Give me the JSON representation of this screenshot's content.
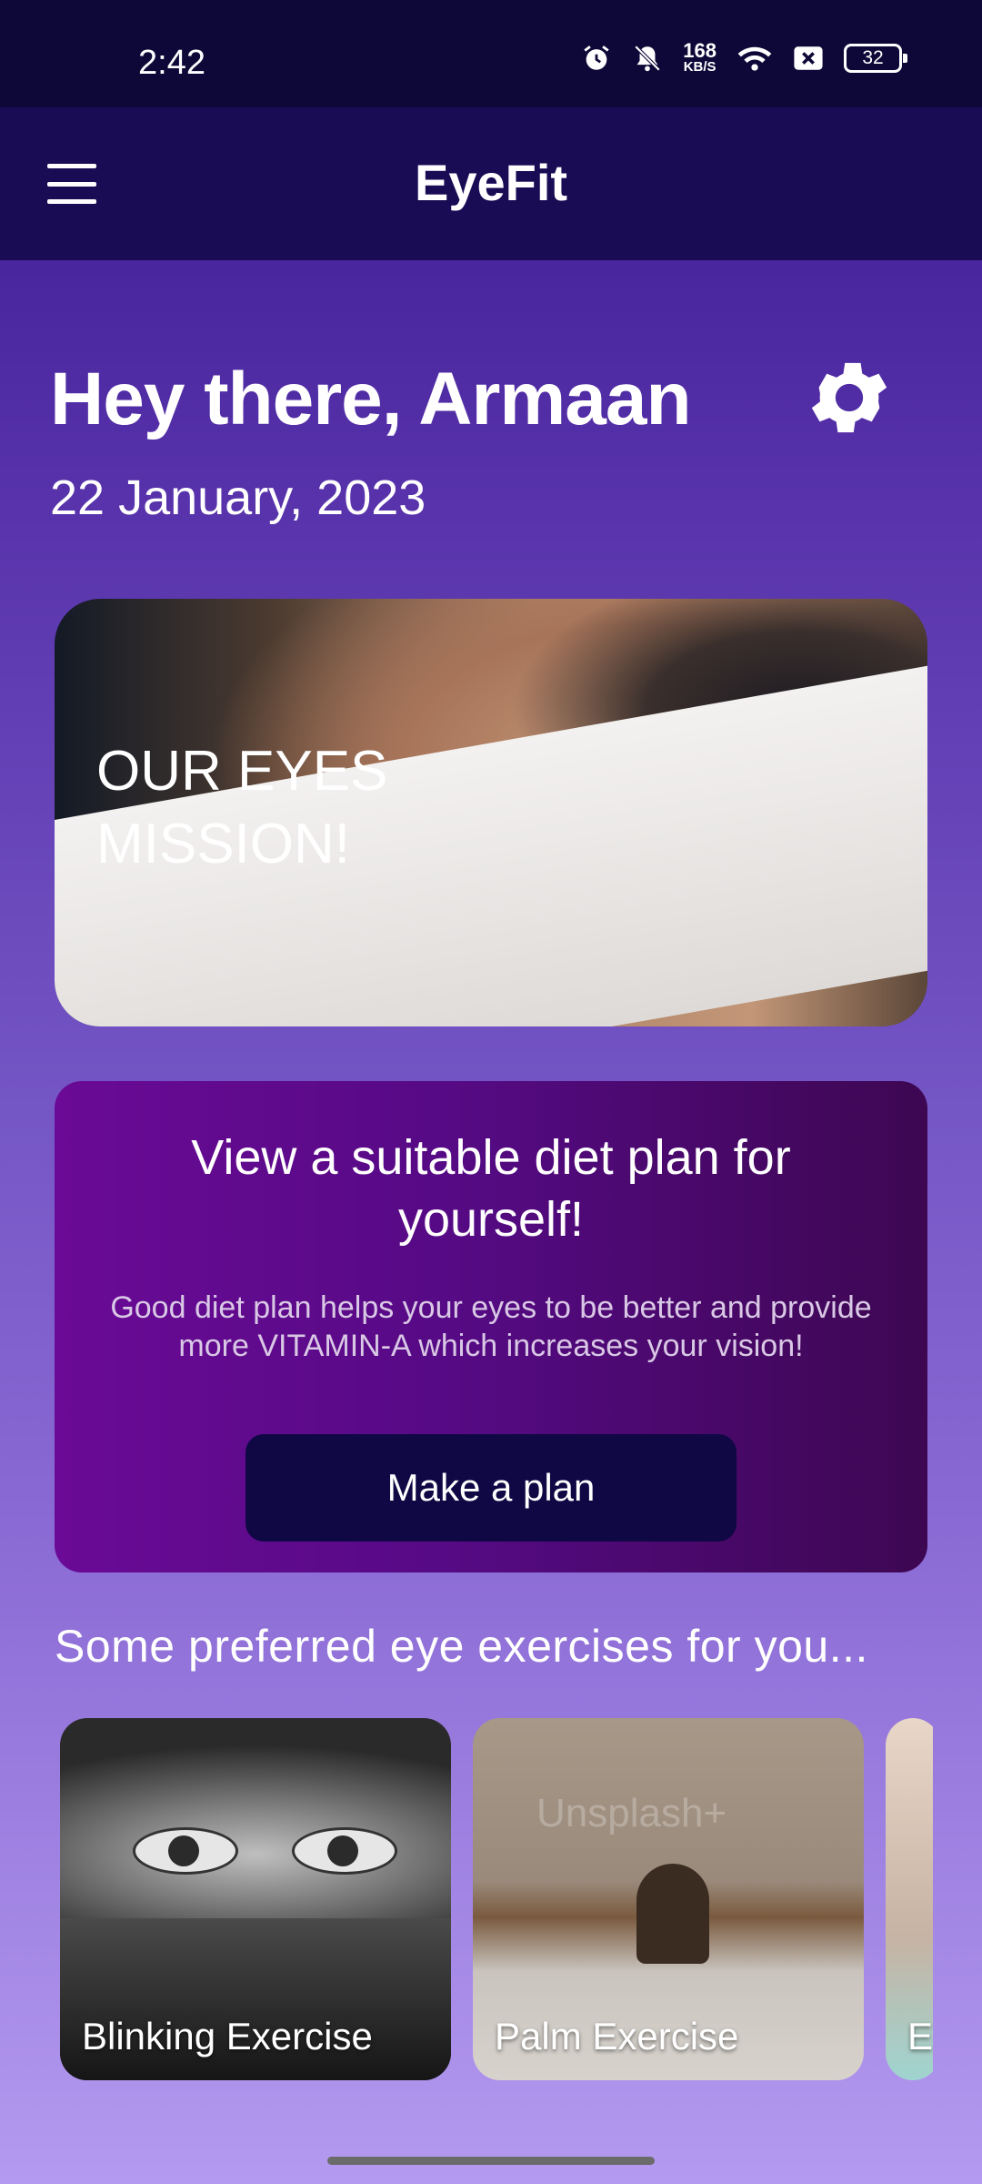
{
  "status_bar": {
    "time": "2:42",
    "net_speed_value": "168",
    "net_speed_unit": "KB/S",
    "battery": "32",
    "icons": [
      "alarm-icon",
      "mute-icon",
      "wifi-icon",
      "sim-x-icon",
      "battery-icon"
    ]
  },
  "app_bar": {
    "title": "EyeFit",
    "menu_icon": "hamburger-menu-icon"
  },
  "greeting": {
    "text": "Hey there, Armaan",
    "date": "22 January, 2023",
    "settings_icon": "gear-icon"
  },
  "hero": {
    "title_line1": "OUR EYES",
    "title_line2": "MISSION!"
  },
  "diet_card": {
    "title": "View a suitable diet plan for yourself!",
    "description": "Good diet plan helps your eyes to be better and provide more VITAMIN-A which increases your vision!",
    "button_label": "Make a plan"
  },
  "exercises": {
    "section_title": "Some preferred eye exercises for you...",
    "items": [
      {
        "label": "Blinking Exercise"
      },
      {
        "label": "Palm Exercise"
      },
      {
        "label": "E"
      }
    ],
    "watermark": "Unsplash+"
  },
  "colors": {
    "status_bar_bg": "#0e0838",
    "app_bar_bg": "#1a0b55",
    "diet_card_bg": "#6a0a96",
    "button_bg": "#0f0845"
  }
}
